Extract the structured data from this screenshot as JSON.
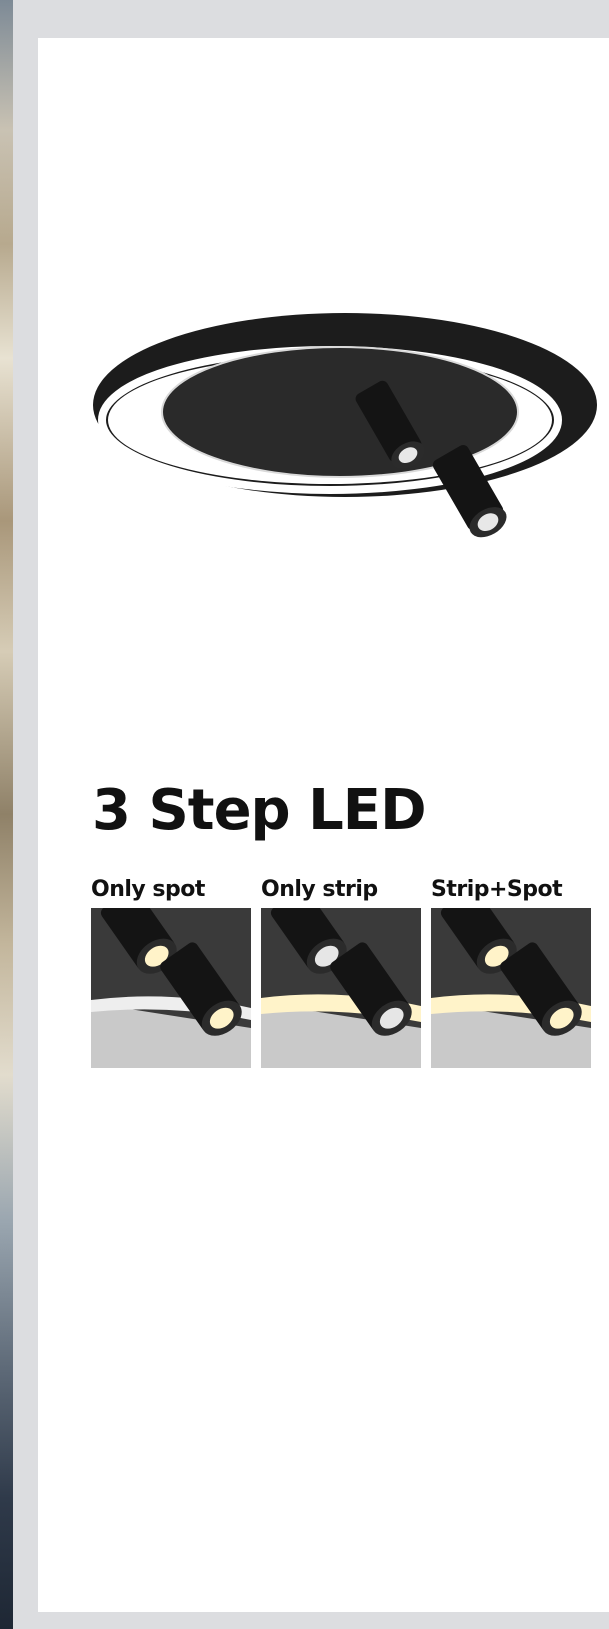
{
  "heading": {
    "title": "3 Step LED"
  },
  "product": {
    "image_icon": "ceiling-ring-light-with-two-spots",
    "color": "#1c1c1c"
  },
  "modes": [
    {
      "label": "Only spot",
      "spot_on": true,
      "strip_on": false
    },
    {
      "label": "Only strip",
      "spot_on": false,
      "strip_on": true
    },
    {
      "label": "Strip+Spot",
      "spot_on": true,
      "strip_on": true
    }
  ],
  "colors": {
    "frame": "#dcdde0",
    "card": "#ffffff",
    "text": "#111111",
    "warm_light": "#fff3c9"
  }
}
